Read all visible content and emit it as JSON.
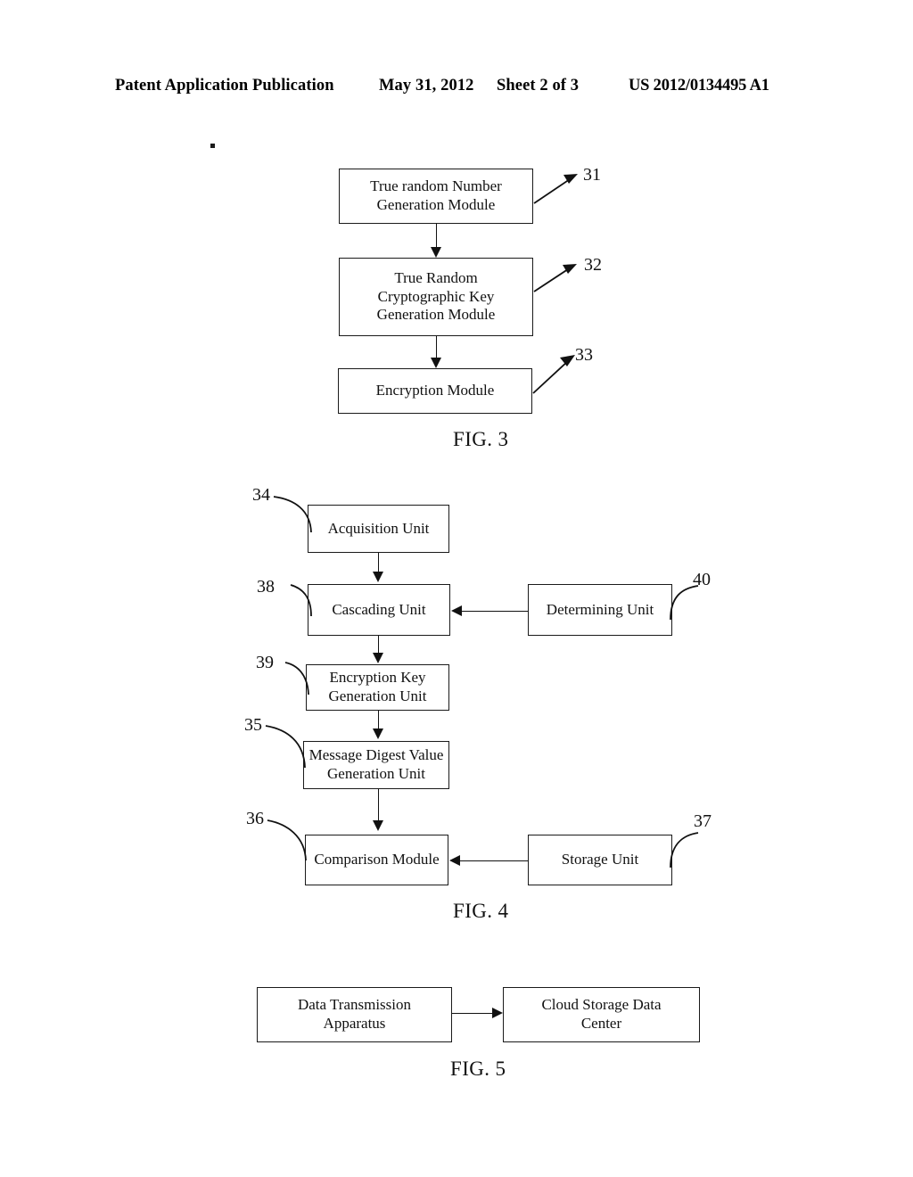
{
  "header": {
    "publication": "Patent Application Publication",
    "date": "May 31, 2012",
    "sheet": "Sheet 2 of 3",
    "publication_number": "US 2012/0134495 A1"
  },
  "figures": [
    {
      "id": "fig3",
      "caption": "FIG. 3",
      "nodes": [
        {
          "key": "true_random_number",
          "label": "True random Number\nGeneration Module",
          "ref": "31"
        },
        {
          "key": "true_random_key",
          "label": "True Random\nCryptographic Key\nGeneration Module",
          "ref": "32"
        },
        {
          "key": "encryption_module",
          "label": "Encryption Module",
          "ref": "33"
        }
      ],
      "refs": [
        "31",
        "32",
        "33"
      ]
    },
    {
      "id": "fig4",
      "caption": "FIG. 4",
      "nodes": [
        {
          "key": "acquisition_unit",
          "label": "Acquisition Unit",
          "ref": "34"
        },
        {
          "key": "cascading_unit",
          "label": "Cascading Unit",
          "ref": "38"
        },
        {
          "key": "determining_unit",
          "label": "Determining Unit",
          "ref": "40"
        },
        {
          "key": "encryption_key_unit",
          "label": "Encryption Key\nGeneration Unit",
          "ref": "39"
        },
        {
          "key": "message_digest_unit",
          "label": "Message Digest Value\nGeneration Unit",
          "ref": "35"
        },
        {
          "key": "comparison_module",
          "label": "Comparison Module",
          "ref": "36"
        },
        {
          "key": "storage_unit",
          "label": "Storage Unit",
          "ref": "37"
        }
      ],
      "refs": [
        "34",
        "38",
        "40",
        "39",
        "35",
        "36",
        "37"
      ]
    },
    {
      "id": "fig5",
      "caption": "FIG. 5",
      "nodes": [
        {
          "key": "data_transmission_apparatus",
          "label": "Data Transmission\nApparatus"
        },
        {
          "key": "cloud_storage_data_center",
          "label": "Cloud Storage Data\nCenter"
        }
      ],
      "refs": []
    }
  ],
  "colors": {
    "ink": "#111111",
    "paper": "#ffffff"
  }
}
